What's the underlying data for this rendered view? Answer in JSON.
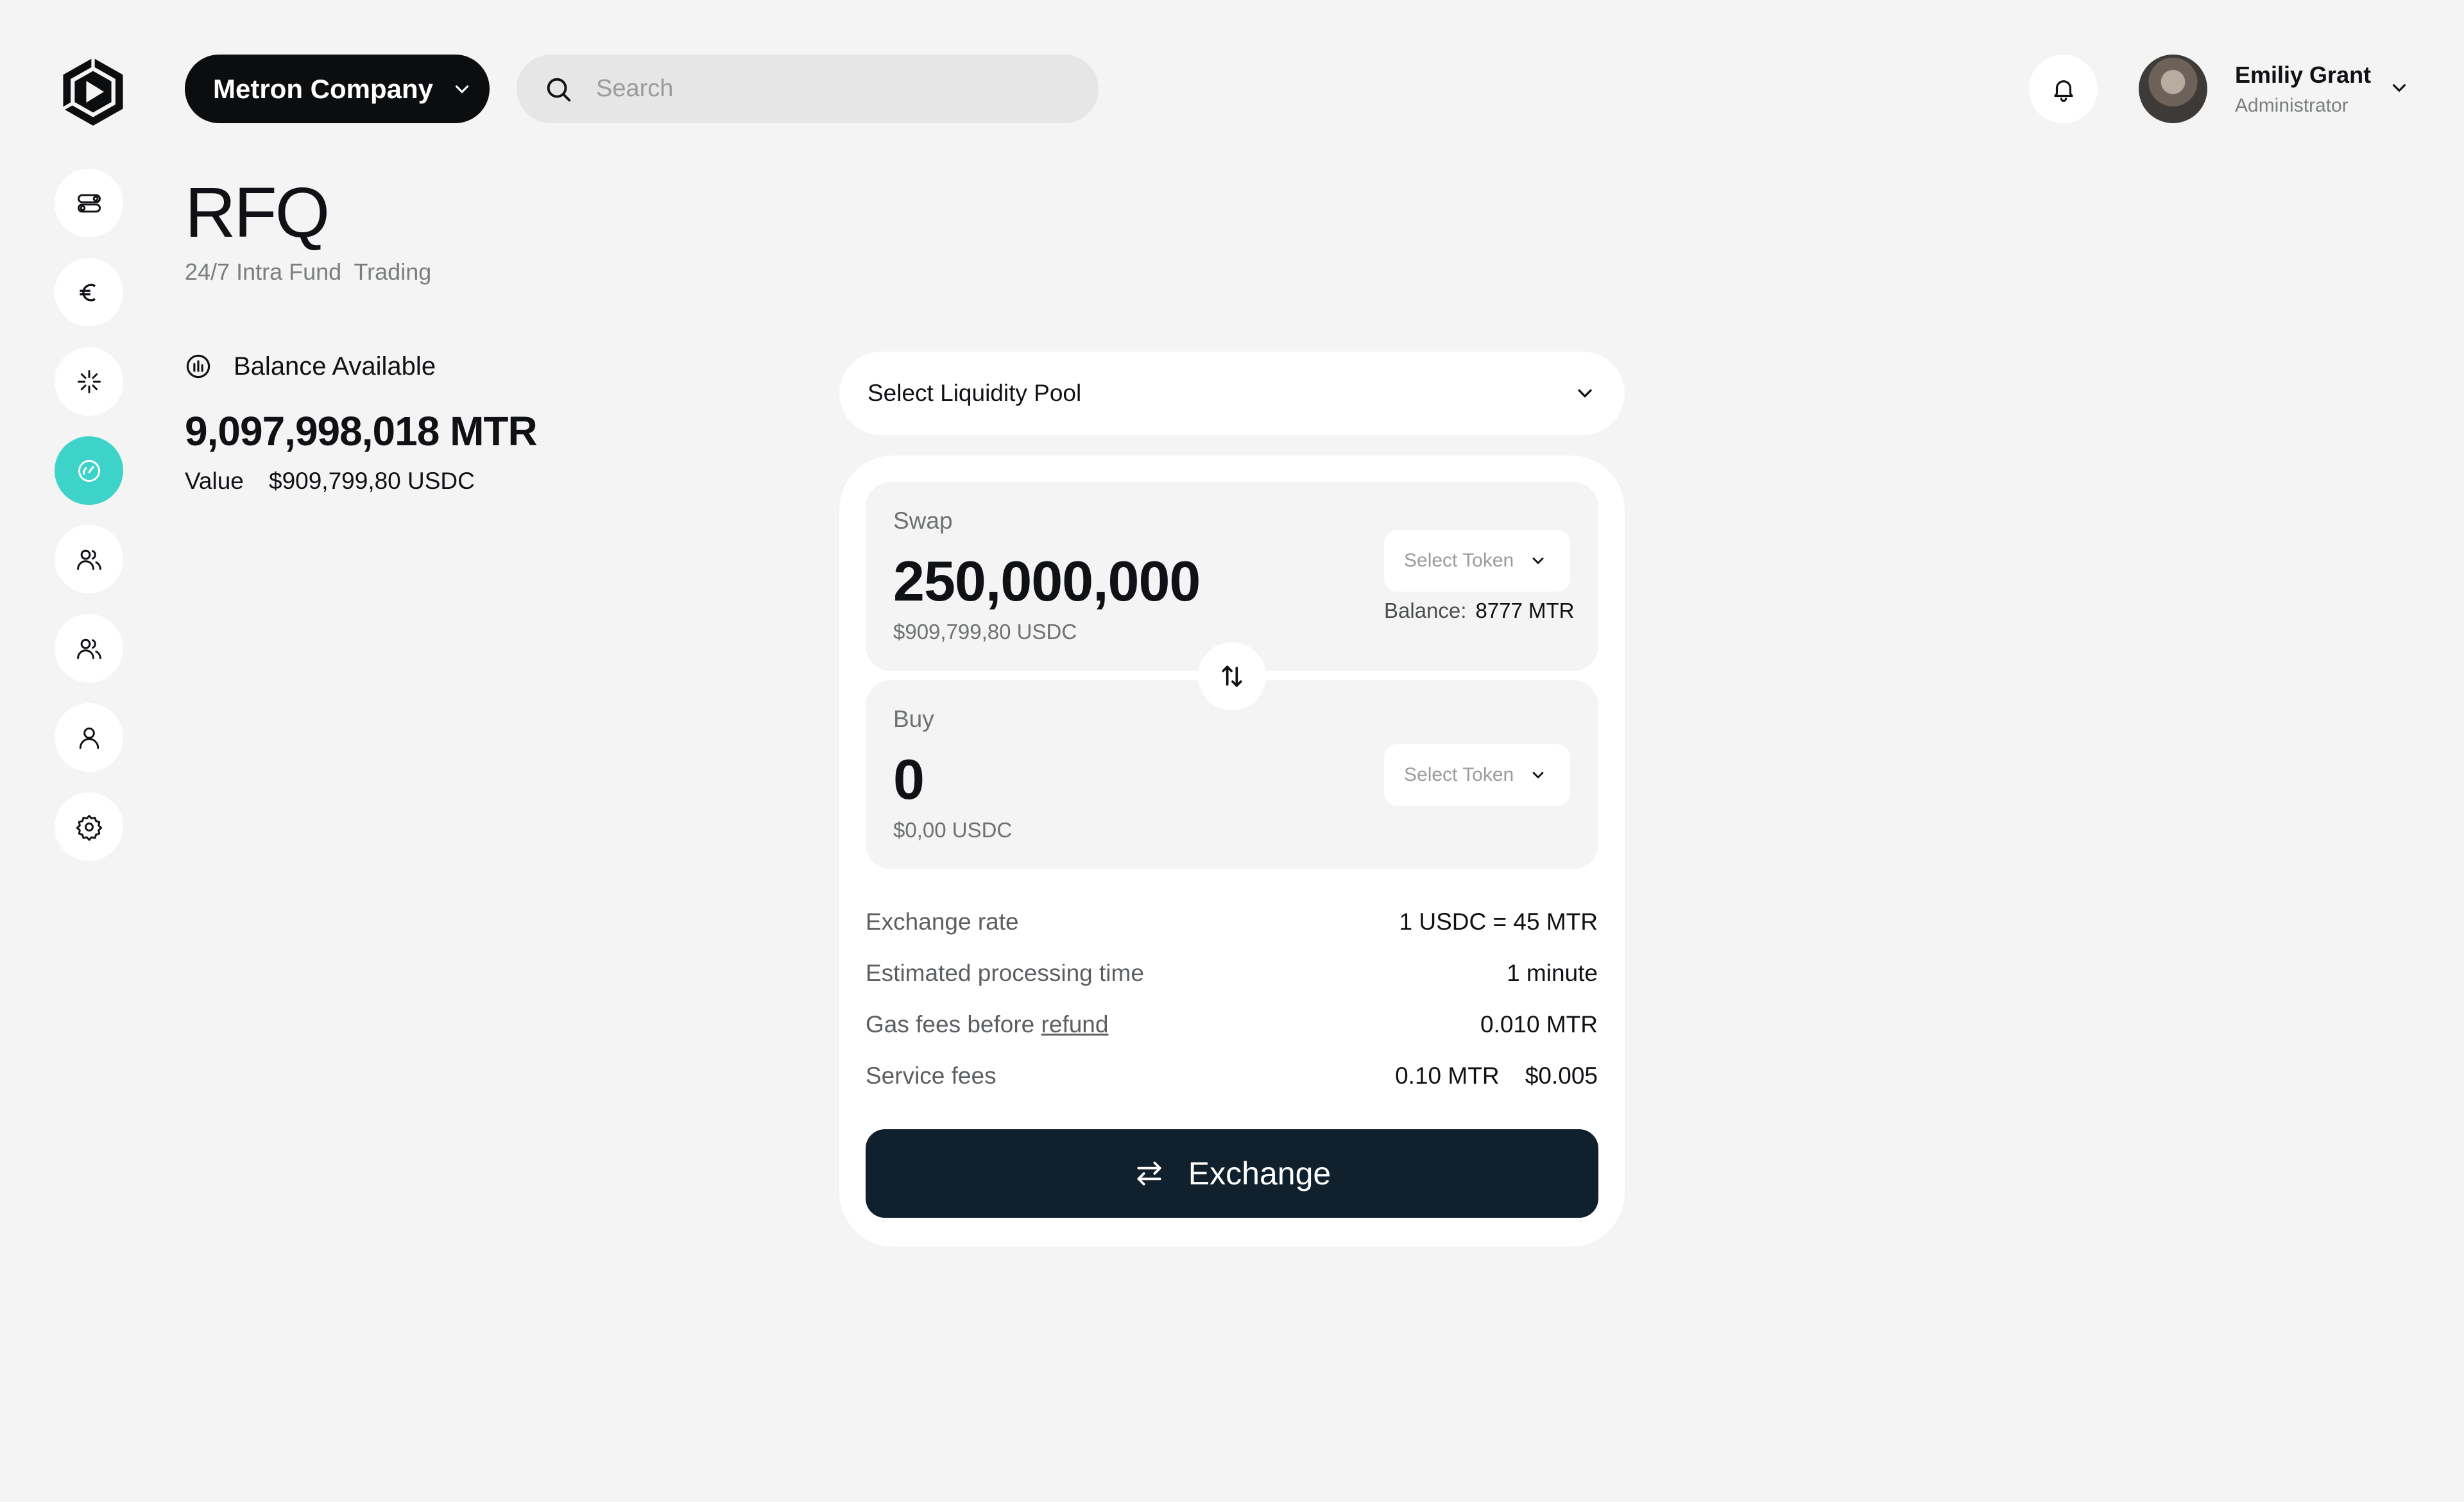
{
  "header": {
    "company": "Metron Company",
    "search_placeholder": "Search",
    "user": {
      "name": "Emiliy Grant",
      "role": "Administrator"
    }
  },
  "sidebar": {
    "items": [
      {
        "icon": "toggles-icon",
        "active": false
      },
      {
        "icon": "euro-icon",
        "active": false
      },
      {
        "icon": "sparkle-icon",
        "active": false
      },
      {
        "icon": "gauge-icon",
        "active": true
      },
      {
        "icon": "users-icon",
        "active": false
      },
      {
        "icon": "users-icon",
        "active": false
      },
      {
        "icon": "user-icon",
        "active": false
      },
      {
        "icon": "gear-icon",
        "active": false
      }
    ]
  },
  "page": {
    "title": "RFQ",
    "subtitle": "24/7 Intra Fund  Trading"
  },
  "balance": {
    "label": "Balance Available",
    "amount": "9,097,998,018 MTR",
    "value_label": "Value",
    "value": "$909,799,80 USDC"
  },
  "pool": {
    "placeholder": "Select Liquidity Pool"
  },
  "swap": {
    "label": "Swap",
    "amount": "250,000,000",
    "usd": "$909,799,80 USDC",
    "token_placeholder": "Select Token",
    "balance_label": "Balance:",
    "balance_value": "8777 MTR"
  },
  "buy": {
    "label": "Buy",
    "amount": "0",
    "usd": "$0,00 USDC",
    "token_placeholder": "Select Token"
  },
  "details": {
    "exchange_rate_label": "Exchange rate",
    "exchange_rate_value": "1 USDC = 45 MTR",
    "processing_label": "Estimated processing time",
    "processing_value": "1 minute",
    "gas_label": "Gas fees before",
    "gas_link": "refund",
    "gas_value": "0.010 MTR",
    "service_label": "Service fees",
    "service_value_mtr": "0.10 MTR",
    "service_value_usd": "$0.005"
  },
  "exchange_button": "Exchange",
  "colors": {
    "accent": "#3dd3c9",
    "primary_button": "#10202d",
    "background": "#f3f4f3"
  }
}
